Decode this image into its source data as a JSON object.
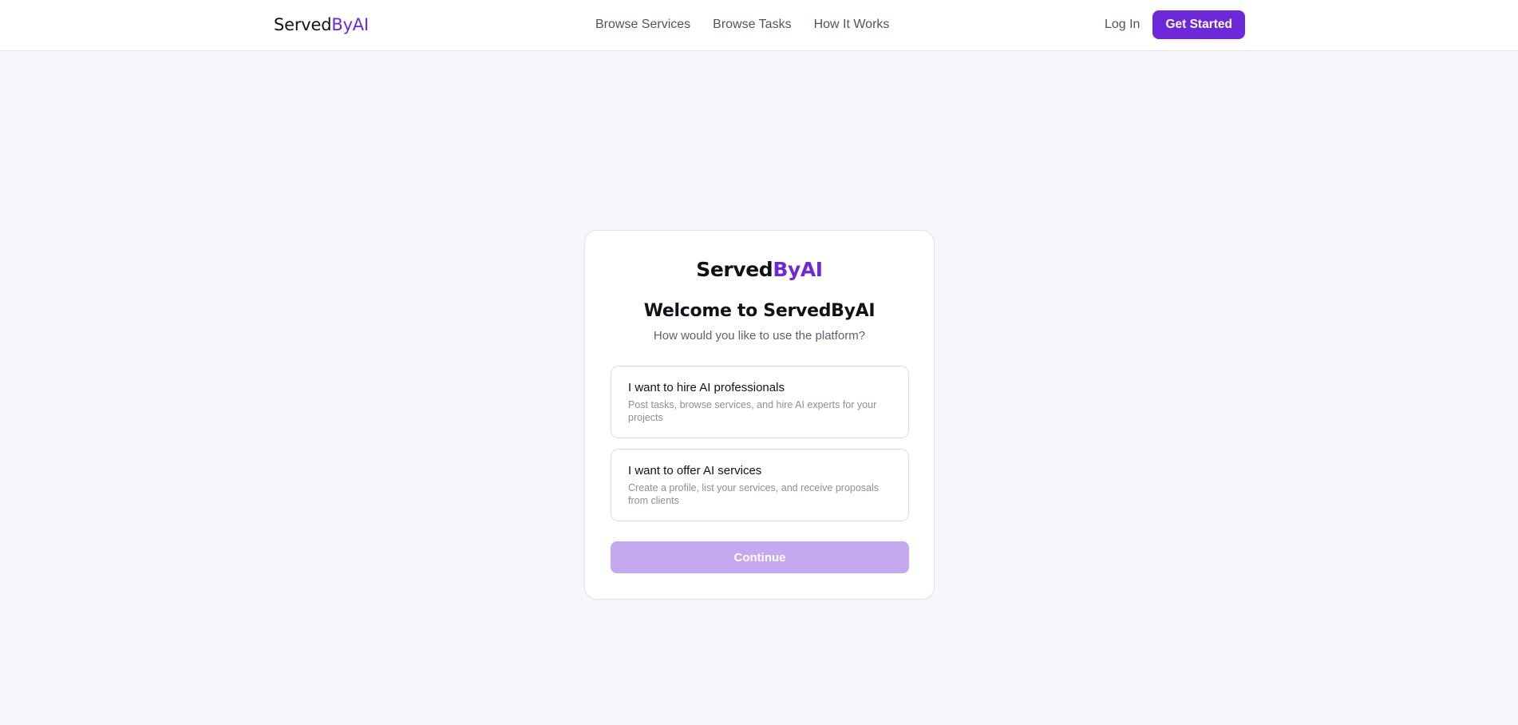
{
  "header": {
    "brand_part1": "Served",
    "brand_part2": "ByAI",
    "nav": [
      "Browse Services",
      "Browse Tasks",
      "How It Works"
    ],
    "login_label": "Log In",
    "cta_label": "Get Started"
  },
  "card": {
    "brand_part1": "Served",
    "brand_part2": "ByAI",
    "title": "Welcome to ServedByAI",
    "subtitle": "How would you like to use the platform?",
    "options": [
      {
        "title": "I want to hire AI professionals",
        "description": "Post tasks, browse services, and hire AI experts for your projects"
      },
      {
        "title": "I want to offer AI services",
        "description": "Create a profile, list your services, and receive proposals from clients"
      }
    ],
    "continue_label": "Continue",
    "continue_enabled": false
  },
  "colors": {
    "accent": "#6d28d9",
    "accent_disabled": "#c4a9f0",
    "page_background": "#f7f7fb"
  }
}
